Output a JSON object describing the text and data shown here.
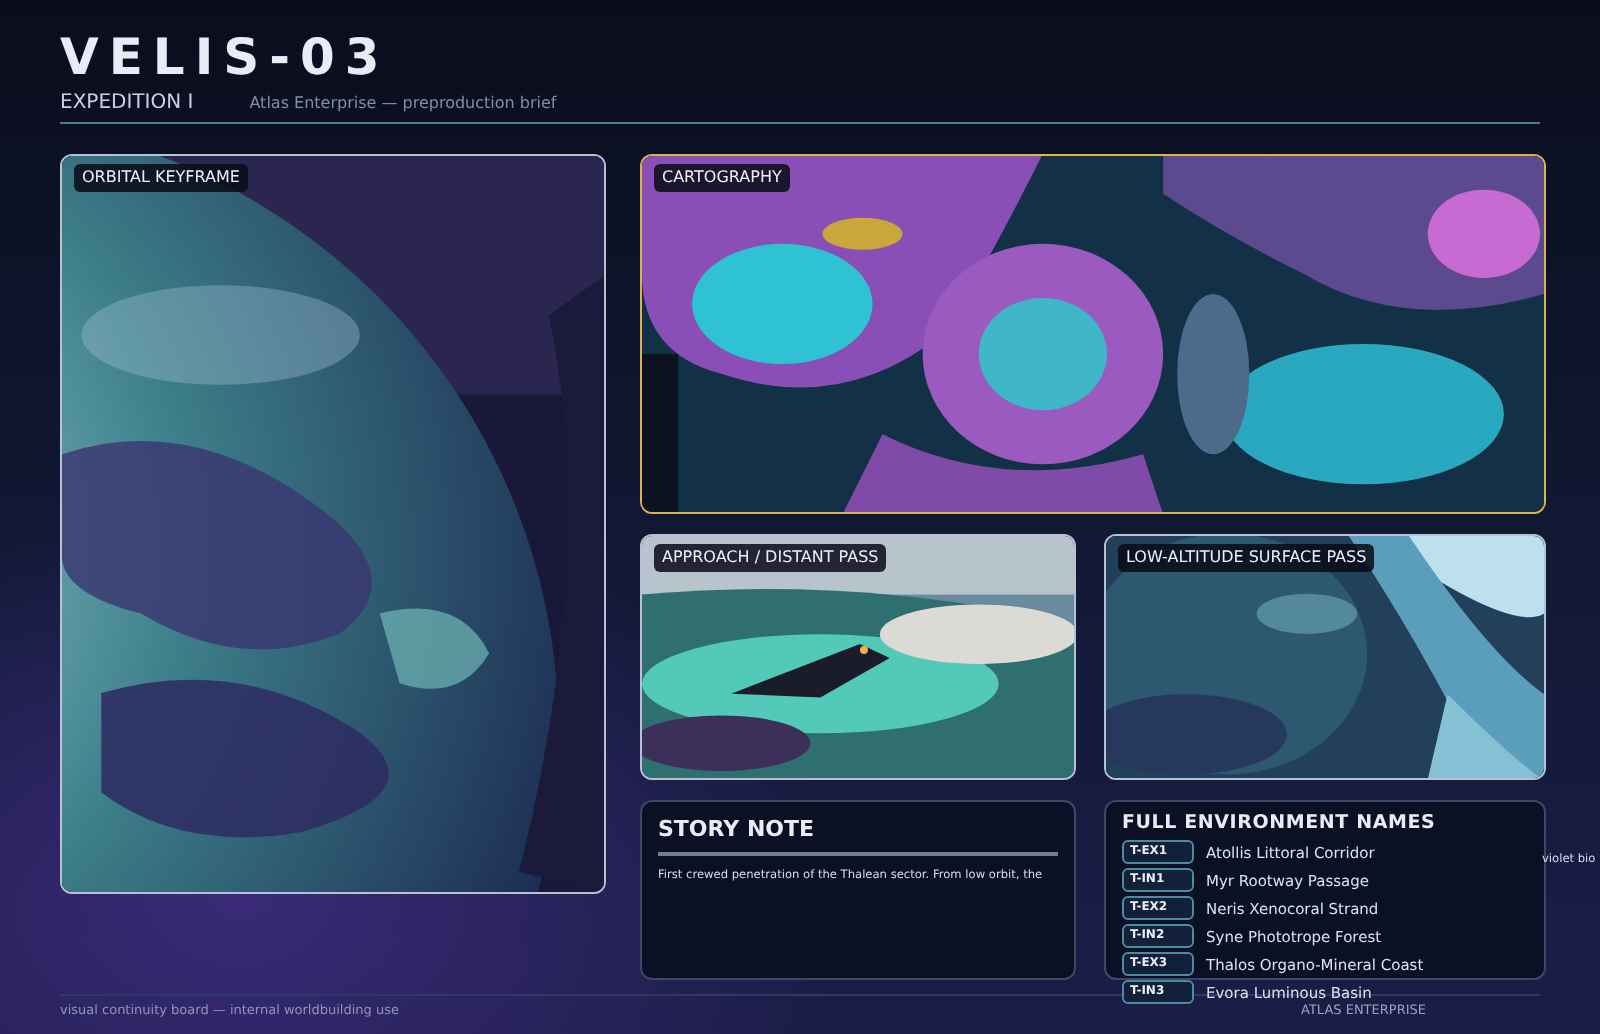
{
  "header": {
    "title": "VELIS-03",
    "subtitle": "EXPEDITION I",
    "tagline": "Atlas Enterprise — preproduction brief"
  },
  "panels": [
    {
      "label": "ORBITAL KEYFRAME",
      "kind": "picture"
    },
    {
      "label": "CARTOGRAPHY",
      "kind": "picture"
    },
    {
      "label": "APPROACH / DISTANT PASS",
      "kind": "picture"
    },
    {
      "label": "LOW-ALTITUDE SURFACE PASS",
      "kind": "picture"
    }
  ],
  "story": {
    "title": "STORY NOTE",
    "text": "First crewed penetration of the Thalean sector. From low orbit, the",
    "overflow": "violet bio"
  },
  "environments": {
    "title": "FULL ENVIRONMENT NAMES",
    "items": [
      {
        "code": "T-EX1",
        "name": "Atollis Littoral Corridor"
      },
      {
        "code": "T-IN1",
        "name": "Myr Rootway Passage"
      },
      {
        "code": "T-EX2",
        "name": "Neris Xenocoral Strand"
      },
      {
        "code": "T-IN2",
        "name": "Syne Phototrope Forest"
      },
      {
        "code": "T-EX3",
        "name": "Thalos Organo-Mineral Coast"
      },
      {
        "code": "T-IN3",
        "name": "Evora Luminous Basin"
      }
    ]
  },
  "footer": {
    "left": "visual continuity board — internal worldbuilding use",
    "right": "ATLAS ENTERPRISE"
  }
}
